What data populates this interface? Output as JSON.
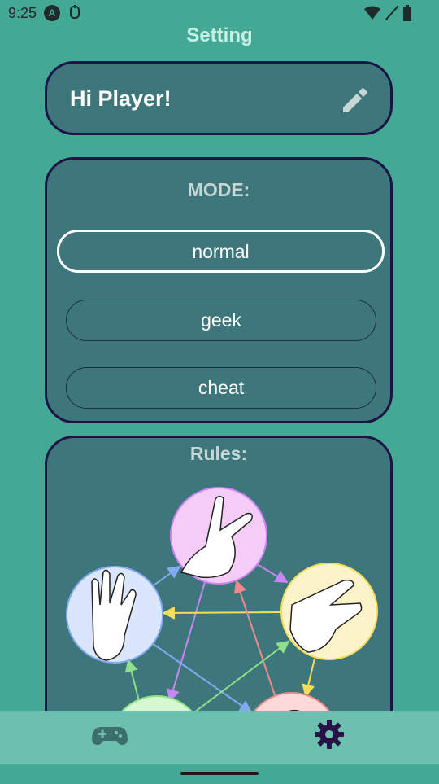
{
  "status_bar": {
    "time": "9:25",
    "icons": [
      "android-auto-icon",
      "notification-icon",
      "wifi-icon",
      "signal-icon",
      "battery-icon"
    ]
  },
  "page": {
    "title": "Setting"
  },
  "greeting": {
    "text": "Hi Player!",
    "icon": "pencil-icon"
  },
  "mode": {
    "label": "MODE:",
    "options": [
      {
        "label": "normal",
        "selected": true
      },
      {
        "label": "geek",
        "selected": false
      },
      {
        "label": "cheat",
        "selected": false
      }
    ]
  },
  "rules": {
    "label": "Rules:",
    "gestures": [
      "scissors-hand",
      "paper-hand",
      "spock-hand",
      "lizard-hand",
      "rock-hand"
    ]
  },
  "bottom_nav": {
    "items": [
      {
        "icon": "gamepad-icon",
        "active": false
      },
      {
        "icon": "gear-icon",
        "active": true
      }
    ]
  },
  "colors": {
    "background": "#43a994",
    "card": "#3e777b",
    "card_border": "#1d1446",
    "nav": "#6bc0b0",
    "active_icon": "#2a1248",
    "inactive_icon": "#3d6e6c"
  }
}
